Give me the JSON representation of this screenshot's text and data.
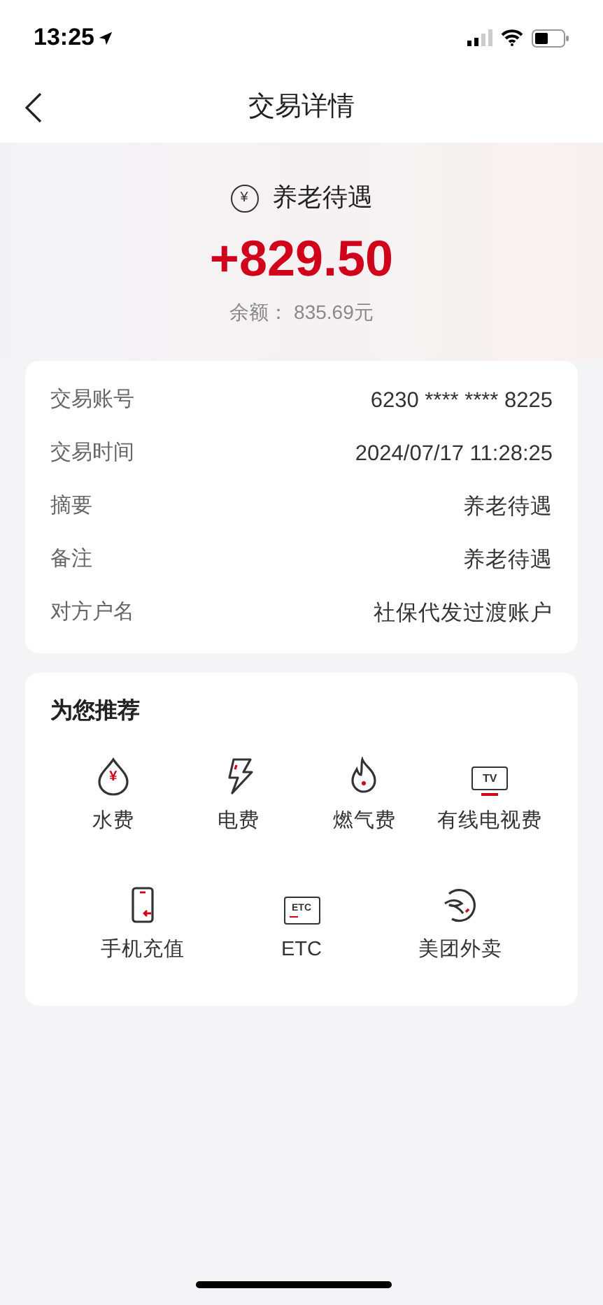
{
  "status_bar": {
    "time": "13:25"
  },
  "nav": {
    "title": "交易详情"
  },
  "summary": {
    "coin_glyph": "¥",
    "category": "养老待遇",
    "amount": "+829.50",
    "balance": "余额： 835.69元"
  },
  "details": [
    {
      "label": "交易账号",
      "value": "6230 **** **** 8225"
    },
    {
      "label": "交易时间",
      "value": "2024/07/17 11:28:25"
    },
    {
      "label": "摘要",
      "value": "养老待遇"
    },
    {
      "label": "备注",
      "value": "养老待遇"
    },
    {
      "label": "对方户名",
      "value": "社保代发过渡账户"
    }
  ],
  "recommend": {
    "title": "为您推荐",
    "shortcuts": [
      {
        "label": "水费",
        "glyph": "¥"
      },
      {
        "label": "电费"
      },
      {
        "label": "燃气费"
      },
      {
        "label": "有线电视费",
        "glyph": "TV"
      },
      {
        "label": "手机充值"
      },
      {
        "label": "ETC",
        "glyph": "ETC"
      },
      {
        "label": "美团外卖"
      }
    ]
  }
}
